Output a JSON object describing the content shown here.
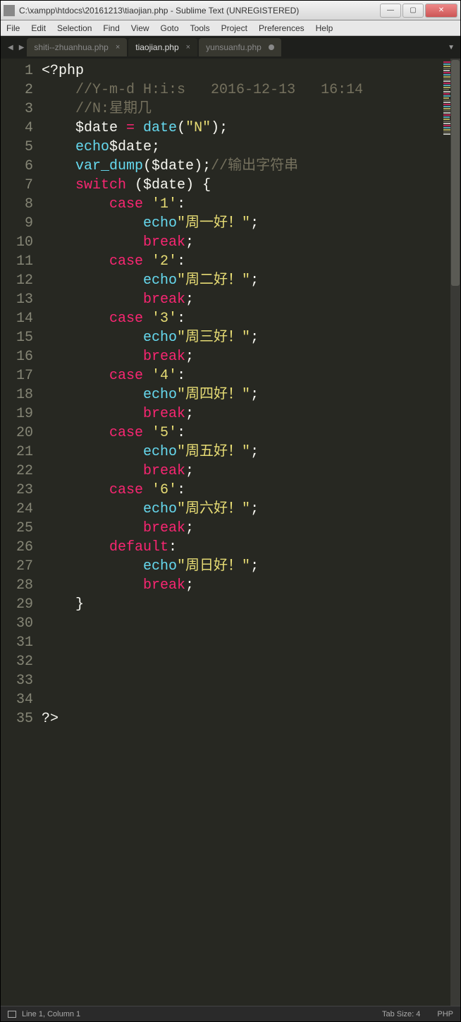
{
  "window": {
    "title": "C:\\xampp\\htdocs\\20161213\\tiaojian.php - Sublime Text (UNREGISTERED)"
  },
  "menu": {
    "file": "File",
    "edit": "Edit",
    "selection": "Selection",
    "find": "Find",
    "view": "View",
    "goto": "Goto",
    "tools": "Tools",
    "project": "Project",
    "preferences": "Preferences",
    "help": "Help"
  },
  "tabs": {
    "t0": {
      "label": "shiti--zhuanhua.php"
    },
    "t1": {
      "label": "tiaojian.php"
    },
    "t2": {
      "label": "yunsuanfu.php"
    }
  },
  "status": {
    "pos": "Line 1, Column 1",
    "tabsize": "Tab Size: 4",
    "lang": "PHP"
  },
  "code": {
    "lines": 35,
    "l1_open": "<?php",
    "l2_cmt": "//Y-m-d H:i:s   2016-12-13   16:14",
    "l3_cmt": "//N:星期几",
    "l4_var": "$date",
    "l4_eq": " = ",
    "l4_fn": "date",
    "l4_p1": "(",
    "l4_str": "\"N\"",
    "l4_p2": ");",
    "l5_echo": "echo",
    "l5_var": "$date",
    "l5_sc": ";",
    "l6_fn": "var_dump",
    "l6_p1": "(",
    "l6_var": "$date",
    "l6_p2": ");",
    "l6_cmt": "//输出字符串",
    "l7_sw": "switch",
    "l7_sp": " (",
    "l7_var": "$date",
    "l7_cp": ") {",
    "case1_kw": "case",
    "case1_sp": " ",
    "case1_val": "'1'",
    "case1_c": ":",
    "echo1_kw": "echo",
    "echo1_str": "\"周一好！\"",
    "echo1_sc": ";",
    "break1": "break",
    "break1_sc": ";",
    "case2_kw": "case",
    "case2_val": "'2'",
    "case2_c": ":",
    "echo2_kw": "echo",
    "echo2_str": "\"周二好！\"",
    "echo2_sc": ";",
    "break2": "break",
    "break2_sc": ";",
    "case3_kw": "case",
    "case3_val": "'3'",
    "case3_c": ":",
    "echo3_kw": "echo",
    "echo3_str": "\"周三好！\"",
    "echo3_sc": ";",
    "break3": "break",
    "break3_sc": ";",
    "case4_kw": "case",
    "case4_val": "'4'",
    "case4_c": ":",
    "echo4_kw": "echo",
    "echo4_str": "\"周四好！\"",
    "echo4_sc": ";",
    "break4": "break",
    "break4_sc": ";",
    "case5_kw": "case",
    "case5_val": "'5'",
    "case5_c": ":",
    "echo5_kw": "echo",
    "echo5_str": "\"周五好！\"",
    "echo5_sc": ";",
    "break5": "break",
    "break5_sc": ";",
    "case6_kw": "case",
    "case6_val": "'6'",
    "case6_c": ":",
    "echo6_kw": "echo",
    "echo6_str": "\"周六好！\"",
    "echo6_sc": ";",
    "break6": "break",
    "break6_sc": ";",
    "default_kw": "default",
    "default_c": ":",
    "echo7_kw": "echo",
    "echo7_str": "\"周日好！\"",
    "echo7_sc": ";",
    "break7": "break",
    "break7_sc": ";",
    "l29_close": "}",
    "l35_close": "?>"
  }
}
